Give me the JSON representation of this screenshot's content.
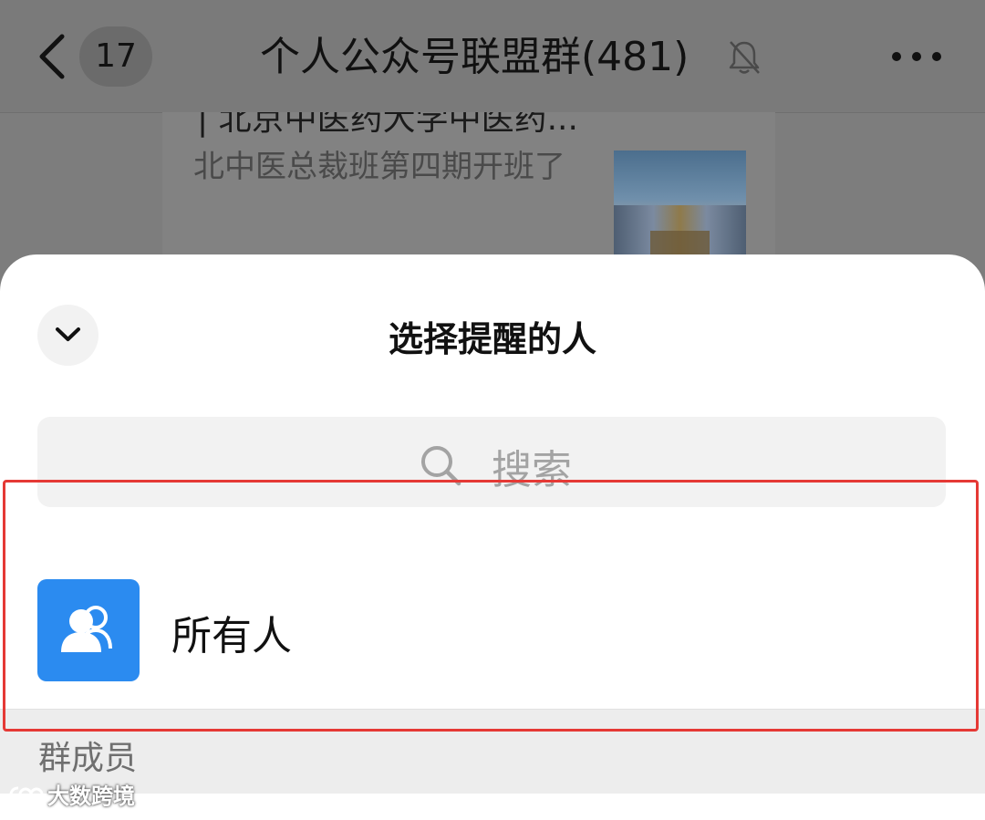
{
  "chat_header": {
    "unread_count": "17",
    "title": "个人公众号联盟群(481)"
  },
  "article": {
    "title_fragment": "| 北京中医药大学中医药...",
    "description": "北中医总裁班第四期开班了"
  },
  "sheet": {
    "title": "选择提醒的人",
    "search_placeholder": "搜索",
    "everyone_label": "所有人",
    "section_label": "群成员"
  },
  "colors": {
    "avatar_blue": "#2b8bf0",
    "highlight_red": "#e53935"
  },
  "icons": [
    "back-arrow-icon",
    "mute-bell-icon",
    "more-icon",
    "chevron-down-icon",
    "search-icon",
    "group-icon"
  ],
  "watermark": "大数跨境"
}
